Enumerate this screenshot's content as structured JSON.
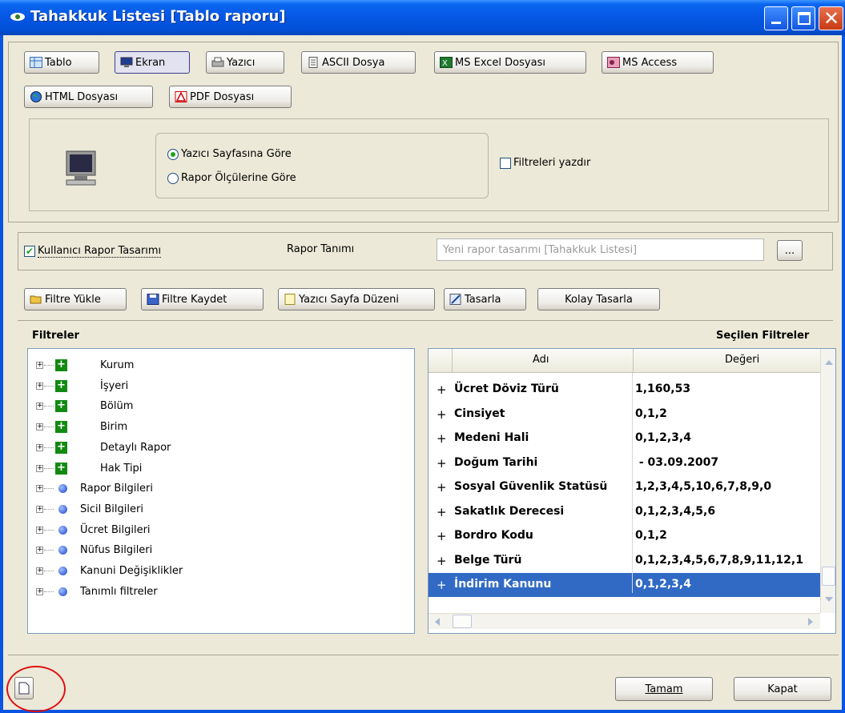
{
  "window": {
    "title": "Tahakkuk Listesi [Tablo raporu]"
  },
  "output_types": [
    "Tablo",
    "Ekran",
    "Yazıcı",
    "ASCII Dosya",
    "MS Excel Dosyası",
    "MS Access",
    "HTML Dosyası",
    "PDF Dosyası"
  ],
  "print_options": {
    "radio1": "Yazıcı Sayfasına Göre",
    "radio2": "Rapor Ölçülerine Göre",
    "checkbox": "Filtreleri yazdır"
  },
  "user_design": {
    "checkbox": "Kullanıcı Rapor Tasarımı",
    "label": "Rapor Tanımı",
    "input_placeholder": "Yeni rapor tasarımı [Tahakkuk Listesi]",
    "browse": "..."
  },
  "toolbar": {
    "load": "Filtre Yükle",
    "save": "Filtre Kaydet",
    "page_setup": "Yazıcı Sayfa Düzeni",
    "design": "Tasarla",
    "easy_design": "Kolay Tasarla"
  },
  "filters": {
    "title": "Filtreler",
    "selected_title": "Seçilen Filtreler",
    "tree": [
      {
        "label": "Kurum",
        "type": "group"
      },
      {
        "label": "İşyeri",
        "type": "group"
      },
      {
        "label": "Bölüm",
        "type": "group"
      },
      {
        "label": "Birim",
        "type": "group"
      },
      {
        "label": "Detaylı Rapor",
        "type": "group"
      },
      {
        "label": "Hak Tipi",
        "type": "group"
      },
      {
        "label": "Rapor Bilgileri",
        "type": "info"
      },
      {
        "label": "Sicil Bilgileri",
        "type": "info"
      },
      {
        "label": "Ücret Bilgileri",
        "type": "info"
      },
      {
        "label": "Nüfus Bilgileri",
        "type": "info"
      },
      {
        "label": "Kanuni Değişiklikler",
        "type": "info"
      },
      {
        "label": "Tanımlı filtreler",
        "type": "info"
      }
    ],
    "columns": [
      "Adı",
      "Değeri"
    ],
    "rows": [
      {
        "name": "Ücret Döviz Türü",
        "value": "1,160,53"
      },
      {
        "name": "Cinsiyet",
        "value": "0,1,2"
      },
      {
        "name": "Medeni Hali",
        "value": "0,1,2,3,4"
      },
      {
        "name": "Doğum Tarihi",
        "value": " - 03.09.2007"
      },
      {
        "name": "Sosyal Güvenlik Statüsü",
        "value": "1,2,3,4,5,10,6,7,8,9,0"
      },
      {
        "name": "Sakatlık Derecesi",
        "value": "0,1,2,3,4,5,6"
      },
      {
        "name": "Bordro Kodu",
        "value": "0,1,2"
      },
      {
        "name": "Belge Türü",
        "value": "0,1,2,3,4,5,6,7,8,9,11,12,1"
      },
      {
        "name": "İndirim Kanunu",
        "value": "0,1,2,3,4"
      }
    ]
  },
  "footer": {
    "ok": "Tamam",
    "close": "Kapat"
  }
}
